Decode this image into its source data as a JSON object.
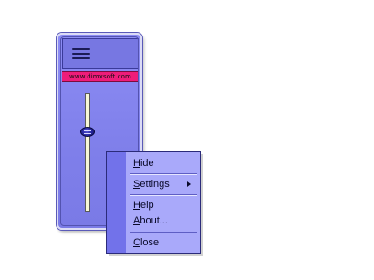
{
  "widget": {
    "url_text": "www.dimxsoft.com",
    "menu_button_icon": "hamburger-icon",
    "volume_level": 0.72
  },
  "context_menu": {
    "items": [
      {
        "label": "Hide",
        "mnemonic": "H",
        "rest": "ide"
      },
      {
        "label": "Settings",
        "mnemonic": "S",
        "rest": "ettings",
        "has_submenu": true,
        "submenu_icon": "chevron-right-icon"
      },
      {
        "label": "Help",
        "mnemonic": "H",
        "rest": "elp"
      },
      {
        "label": "About...",
        "mnemonic": "A",
        "rest": "bout..."
      },
      {
        "label": "Close",
        "mnemonic": "C",
        "rest": "lose"
      }
    ]
  },
  "colors": {
    "widget_body": "#8c8cf4",
    "url_bar": "#ee1c7a",
    "menu_background": "#a9a9fa",
    "menu_stripe": "#7272ea",
    "slider_track": "#f7f7d6",
    "slider_knob": "#2727a0"
  }
}
